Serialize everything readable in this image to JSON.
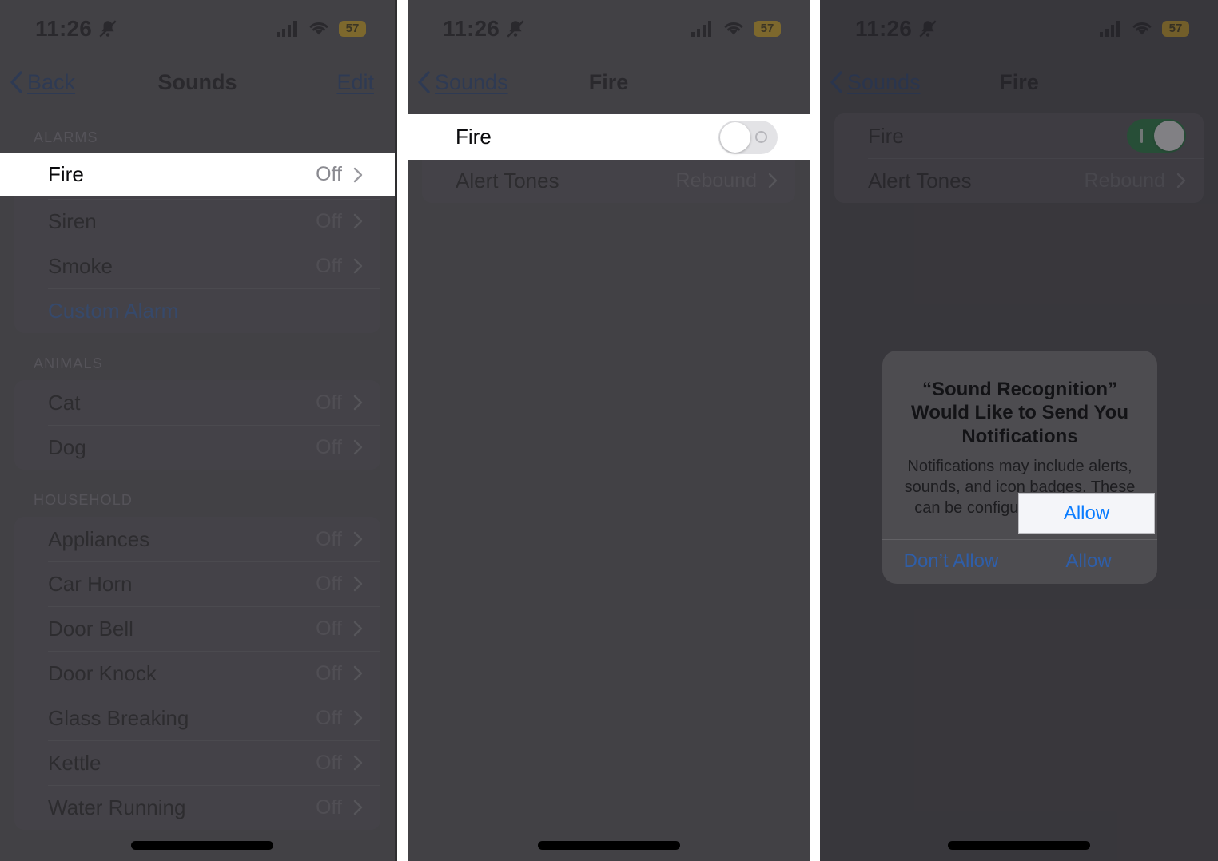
{
  "status_bar": {
    "time": "11:26",
    "bell_icon": "bell-slash-icon",
    "cellular_icon": "cellular-bars-icon",
    "wifi_icon": "wifi-icon",
    "battery_level": "57"
  },
  "panel1": {
    "nav": {
      "back_label": "Back",
      "title": "Sounds",
      "edit_label": "Edit"
    },
    "sections": [
      {
        "header": "ALARMS",
        "rows": [
          {
            "label": "Fire",
            "value": "Off",
            "highlighted": true
          },
          {
            "label": "Siren",
            "value": "Off"
          },
          {
            "label": "Smoke",
            "value": "Off"
          },
          {
            "label": "Custom Alarm",
            "value": "",
            "link": true
          }
        ]
      },
      {
        "header": "ANIMALS",
        "rows": [
          {
            "label": "Cat",
            "value": "Off"
          },
          {
            "label": "Dog",
            "value": "Off"
          }
        ]
      },
      {
        "header": "HOUSEHOLD",
        "rows": [
          {
            "label": "Appliances",
            "value": "Off"
          },
          {
            "label": "Car Horn",
            "value": "Off"
          },
          {
            "label": "Door Bell",
            "value": "Off"
          },
          {
            "label": "Door Knock",
            "value": "Off"
          },
          {
            "label": "Glass Breaking",
            "value": "Off"
          },
          {
            "label": "Kettle",
            "value": "Off"
          },
          {
            "label": "Water Running",
            "value": "Off"
          }
        ]
      }
    ]
  },
  "panel2": {
    "nav": {
      "back_label": "Sounds",
      "title": "Fire"
    },
    "rows": {
      "fire_label": "Fire",
      "fire_toggle_state": "off",
      "alert_tones_label": "Alert Tones",
      "alert_tones_value": "Rebound"
    }
  },
  "panel3": {
    "nav": {
      "back_label": "Sounds",
      "title": "Fire"
    },
    "rows": {
      "fire_label": "Fire",
      "fire_toggle_state": "on",
      "alert_tones_label": "Alert Tones",
      "alert_tones_value": "Rebound"
    },
    "alert": {
      "title": "“Sound Recognition” Would Like to Send You Notifications",
      "message": "Notifications may include alerts, sounds, and icon badges. These can be configured in Settings.",
      "dont_allow_label": "Don’t Allow",
      "allow_label": "Allow"
    }
  },
  "colors": {
    "toggle_on": "#137c35",
    "toggle_off": "#e3e3e6",
    "link_blue": "#2f5ea8",
    "allow_blue": "#0a7cff",
    "battery_badge": "#d7a714"
  }
}
